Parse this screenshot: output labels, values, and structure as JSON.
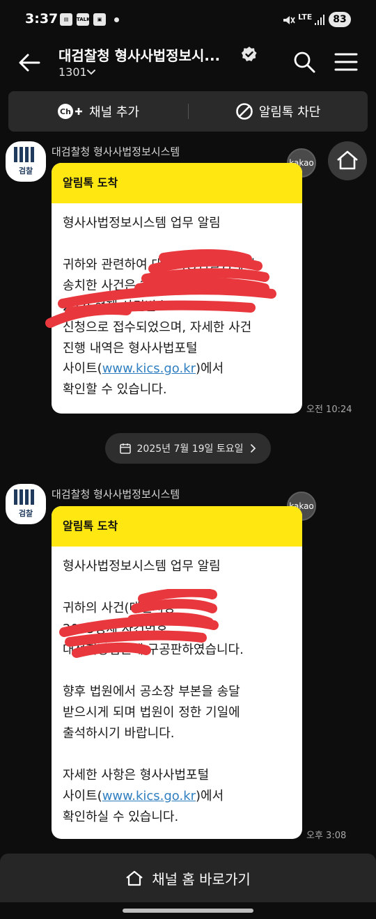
{
  "status_bar": {
    "time": "3:37",
    "icons": [
      "flipboard-icon",
      "talk-icon",
      "contact-icon"
    ],
    "talk_label": "TALK",
    "network": "LTE",
    "battery": "83"
  },
  "header": {
    "title": "대검찰청 형사사법정보시...",
    "member_count": "1301"
  },
  "channel_bar": {
    "add_label": "채널 추가",
    "add_icon_text": "Ch+",
    "block_label": "알림톡 차단"
  },
  "messages": [
    {
      "sender": "대검찰청 형사사법정보시스템",
      "avatar_text": "검찰",
      "badge": "kakao",
      "header": "알림톡 도착",
      "paragraphs": [
        [
          "형사사법정보시스템 업무 알림"
        ],
        [
          "귀하와 관련하여 대전지방검찰청에서",
          "송치한 사건은 2025년 대전지검",
          "2025형제 사건번호",
          "신청으로 접수되었으며, 자세한 사건",
          "진행 내역은 형사사법포털"
        ],
        [
          "사이트(",
          "www.kics.go.kr",
          ")에서",
          "확인할 수 있습니다."
        ]
      ],
      "time": "오전 10:24"
    },
    {
      "sender": "대검찰청 형사사법정보시스템",
      "avatar_text": "검찰",
      "badge": "kakao",
      "header": "알림톡 도착",
      "paragraphs": [
        [
          "형사사법정보시스템 업무 알림"
        ],
        [
          "귀하의 사건(대전지방",
          "2025형제 사건번호",
          "대전지방법원에 구공판하였습니다."
        ],
        [
          "향후 법원에서 공소장 부본을 송달",
          "받으시게 되며 법원이 정한 기일에",
          "출석하시기 바랍니다."
        ],
        [
          "자세한 사항은 형사사법포털",
          "사이트(",
          "www.kics.go.kr",
          ")에서",
          "확인하실 수 있습니다."
        ]
      ],
      "time": "오후 3:08"
    }
  ],
  "date_divider": "2025년 7월 19일 토요일",
  "bottom_bar": {
    "home_label": "채널 홈 바로가기"
  },
  "colors": {
    "background": "#0d0d0d",
    "notice_header": "#ffe812",
    "link": "#2f7fc0",
    "redaction": "#e8383d"
  }
}
